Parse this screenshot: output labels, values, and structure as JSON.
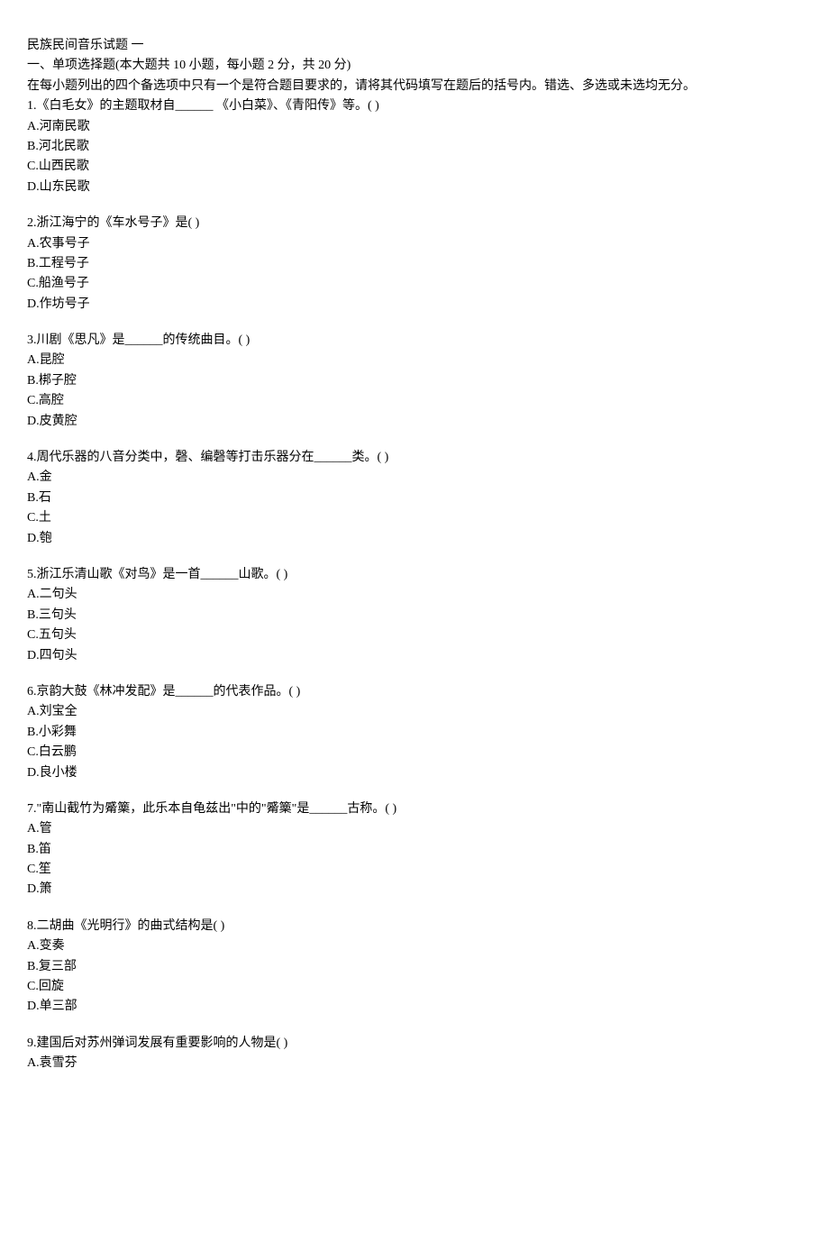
{
  "title": "民族民间音乐试题 一",
  "section_header": "一、单项选择题(本大题共 10 小题，每小题 2 分，共 20 分)",
  "instruction": "在每小题列出的四个备选项中只有一个是符合题目要求的，请将其代码填写在题后的括号内。错选、多选或未选均无分。",
  "questions": [
    {
      "stem": "1.《白毛女》的主题取材自______ 《小白菜》、《青阳传》等。( )",
      "options": [
        "A.河南民歌",
        "B.河北民歌",
        "C.山西民歌",
        "D.山东民歌"
      ]
    },
    {
      "stem": "2.浙江海宁的《车水号子》是( )",
      "options": [
        "A.农事号子",
        "B.工程号子",
        "C.船渔号子",
        "D.作坊号子"
      ]
    },
    {
      "stem": "3.川剧《思凡》是______的传统曲目。( )",
      "options": [
        "A.昆腔",
        "B.梆子腔",
        "C.高腔",
        "D.皮黄腔"
      ]
    },
    {
      "stem": "4.周代乐器的八音分类中，磬、编磬等打击乐器分在______类。( )",
      "options": [
        "A.金",
        "B.石",
        "C.土",
        "D.匏"
      ]
    },
    {
      "stem": "5.浙江乐清山歌《对鸟》是一首______山歌。( )",
      "options": [
        "A.二句头",
        "B.三句头",
        "C.五句头",
        "D.四句头"
      ]
    },
    {
      "stem": "6.京韵大鼓《林冲发配》是______的代表作品。( )",
      "options": [
        "A.刘宝全",
        "B.小彩舞",
        "C.白云鹏",
        "D.良小楼"
      ]
    },
    {
      "stem": "7.\"南山截竹为觱篥，此乐本自龟兹出\"中的\"觱篥\"是______古称。( )",
      "options": [
        "A.管",
        "B.笛",
        "C.笙",
        "D.箫"
      ]
    },
    {
      "stem": "8.二胡曲《光明行》的曲式结构是( )",
      "options": [
        "A.变奏",
        "B.复三部",
        "C.回旋",
        "D.单三部"
      ]
    },
    {
      "stem": "9.建国后对苏州弹词发展有重要影响的人物是( )",
      "options": [
        "A.袁雪芬"
      ]
    }
  ]
}
